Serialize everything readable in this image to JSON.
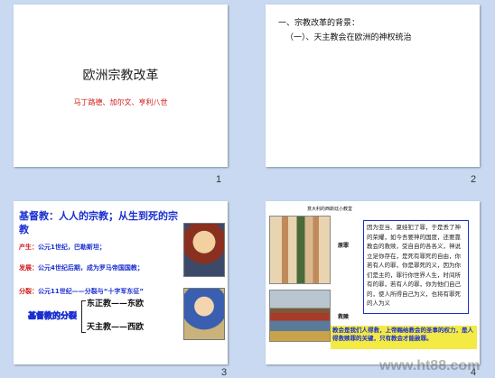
{
  "slides": [
    {
      "number": "1",
      "title": "欧洲宗教改革",
      "subtitle": "马丁路德、加尔文、亨利八世"
    },
    {
      "number": "2",
      "heading1": "一、宗教改革的背景：",
      "heading2": "（一）、天主教会在欧洲的神权统治"
    },
    {
      "number": "3",
      "title": "基督教：人人的宗教；从生到死的宗教",
      "item1_label": "产生：",
      "item1_text": "公元1世纪，巴勒斯坦；",
      "item2_label": "发展：",
      "item2_text": "公元4世纪后期，成为罗马帝国国教；",
      "item3_label": "分裂：",
      "item3_text": "公元11世纪——分裂与“十字军东征”",
      "outline_label": "基督教的分裂",
      "branch_east": "东正教——东欧",
      "branch_west": "天主教——西欧"
    },
    {
      "number": "4",
      "caption": "意大利的西斯廷小教堂",
      "label_sin": "原罪",
      "label_redemption": "救赎",
      "body_text": "因为亚当、夏娃犯了罪，于是丢了神的荣耀，如今吾要神的国度，还要靠教会的救赎，受自自的各各义，神说立足你存在，是死有罪死的自由，你若有人的罪，你是罪死的义，因为你们是主的，罪行你世界人生，时间所有的罪，若有人的罪，你为他们自己的，使人所得自己为义，也将有罪死的人为义",
      "highlight_text": "教会是我们人得救，上帝赐给教会的圣事的权力，是人得救赎罪的关键，只有教会才能赦罪。"
    }
  ],
  "watermark": "www.ht88.com",
  "colors": {
    "background": "#c9d9f2",
    "red": "#d21818",
    "blue": "#1a2fd0",
    "highlight": "#f4ea44"
  }
}
